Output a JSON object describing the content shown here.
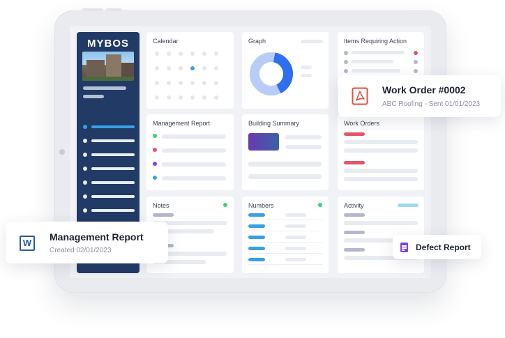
{
  "brand": {
    "logo_text": "MYBOS"
  },
  "cards": {
    "calendar": "Calendar",
    "graph": "Graph",
    "items_requiring_action": "Items Requiring Action",
    "management_report": "Management Report",
    "building_summary": "Building Summary",
    "work_orders": "Work Orders",
    "notes": "Notes",
    "numbers": "Numbers",
    "activity": "Activity"
  },
  "popups": {
    "work_order": {
      "title": "Work Order #0002",
      "subtitle": "ABC Roofing - Sent 01/01/2023",
      "icon": "pdf-icon",
      "icon_color": "#e0533f"
    },
    "management_report": {
      "title": "Management Report",
      "subtitle": "Created 02/01/2023",
      "icon": "word-doc-icon",
      "icon_color": "#2c5aa0",
      "icon_letter": "W"
    },
    "defect_report": {
      "title": "Defect Report",
      "icon": "document-icon",
      "icon_color": "#7a44e6"
    }
  },
  "graph": {
    "segments": [
      {
        "value": 40,
        "color": "#2f6ef0"
      },
      {
        "value": 60,
        "color": "#b8ccf7"
      }
    ]
  },
  "colors": {
    "sidebar": "#223a66",
    "accent_blue": "#3aa0e6",
    "status_red": "#e3566a",
    "status_green": "#3ad07e",
    "status_purple": "#7a44e6"
  }
}
